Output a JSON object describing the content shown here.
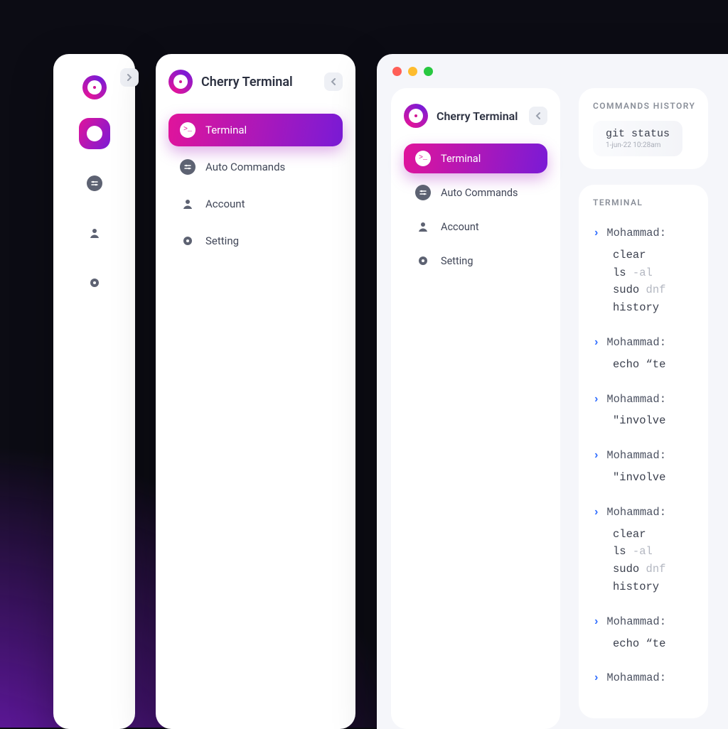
{
  "brand": "Cherry Terminal",
  "nav": {
    "terminal": {
      "label": "Terminal"
    },
    "autocmd": {
      "label": "Auto Commands"
    },
    "account": {
      "label": "Account"
    },
    "setting": {
      "label": "Setting"
    }
  },
  "history": {
    "title": "COMMANDS HISTORY",
    "items": [
      {
        "cmd": "git status",
        "time": "1-jun-22 10:28am"
      }
    ]
  },
  "terminal": {
    "title": "TERMINAL",
    "user": "Mohammad:",
    "blocks": [
      {
        "lines": [
          {
            "t": "clear",
            "dim": ""
          },
          {
            "t": "ls ",
            "dim": "-al"
          },
          {
            "t": "sudo ",
            "dim": "dnf"
          },
          {
            "t": "history",
            "dim": ""
          }
        ]
      },
      {
        "lines": [
          {
            "t": "echo “te",
            "dim": ""
          }
        ]
      },
      {
        "lines": [
          {
            "t": "\"involve",
            "dim": ""
          }
        ]
      },
      {
        "lines": [
          {
            "t": "\"involve",
            "dim": ""
          }
        ]
      },
      {
        "lines": [
          {
            "t": "clear",
            "dim": ""
          },
          {
            "t": "ls ",
            "dim": "-al"
          },
          {
            "t": "sudo ",
            "dim": "dnf"
          },
          {
            "t": "history",
            "dim": ""
          }
        ]
      },
      {
        "lines": [
          {
            "t": "echo “te",
            "dim": ""
          }
        ]
      },
      {
        "lines": [
          {
            "t": "",
            "dim": ""
          }
        ]
      }
    ]
  }
}
